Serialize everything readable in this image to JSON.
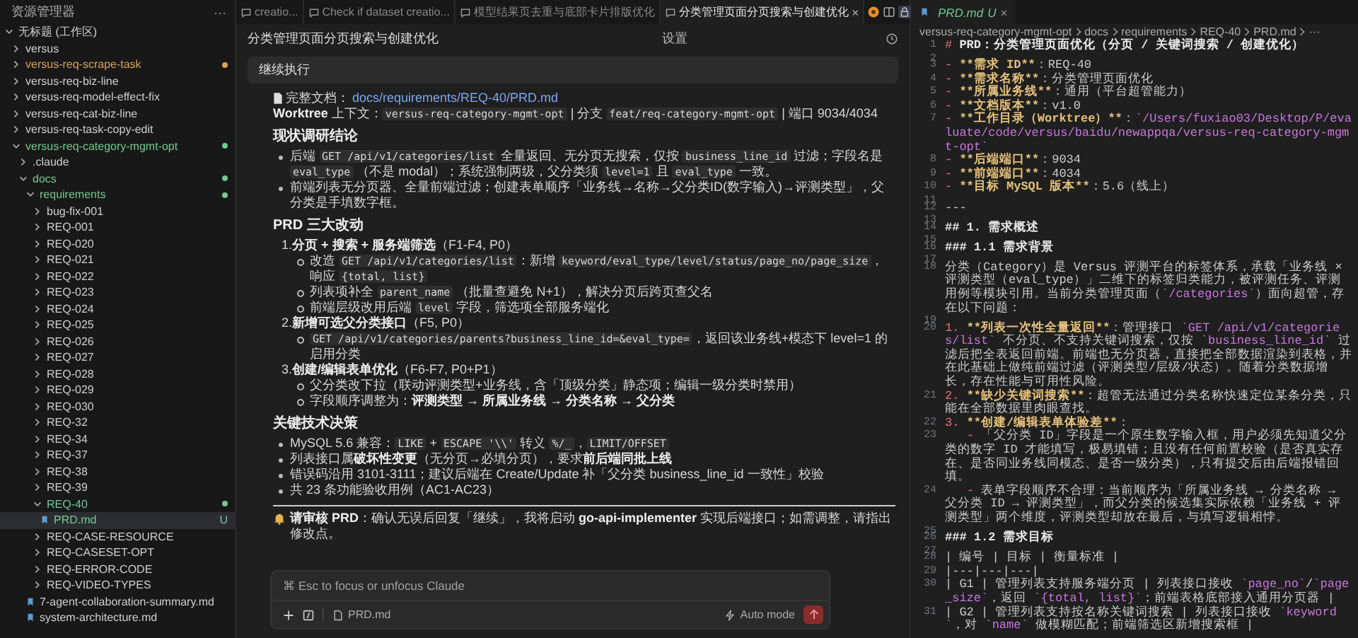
{
  "sidebar": {
    "title": "资源管理器",
    "menu": "···",
    "tree": [
      {
        "name": "无标题 (工作区)",
        "kind": "folder",
        "expanded": true,
        "children": [
          {
            "name": "versus",
            "kind": "folder",
            "expanded": false
          },
          {
            "name": "versus-req-scrape-task",
            "kind": "folder",
            "expanded": false,
            "color": "#d7a15b"
          },
          {
            "name": "versus-req-biz-line",
            "kind": "folder",
            "expanded": false
          },
          {
            "name": "versus-req-model-effect-fix",
            "kind": "folder",
            "expanded": false
          },
          {
            "name": "versus-req-cat-biz-line",
            "kind": "folder",
            "expanded": false
          },
          {
            "name": "versus-req-task-copy-edit",
            "kind": "folder",
            "expanded": false
          },
          {
            "name": "versus-req-category-mgmt-opt",
            "kind": "folder",
            "expanded": true,
            "color": "#73c991",
            "children": [
              {
                "name": ".claude",
                "kind": "folder",
                "expanded": false
              },
              {
                "name": "docs",
                "kind": "folder",
                "expanded": true,
                "color": "#73c991",
                "children": [
                  {
                    "name": "requirements",
                    "kind": "folder",
                    "expanded": true,
                    "color": "#73c991",
                    "children": [
                      {
                        "name": "bug-fix-001",
                        "kind": "folder",
                        "expanded": false
                      },
                      {
                        "name": "REQ-001",
                        "kind": "folder",
                        "expanded": false
                      },
                      {
                        "name": "REQ-020",
                        "kind": "folder",
                        "expanded": false
                      },
                      {
                        "name": "REQ-021",
                        "kind": "folder",
                        "expanded": false
                      },
                      {
                        "name": "REQ-022",
                        "kind": "folder",
                        "expanded": false
                      },
                      {
                        "name": "REQ-023",
                        "kind": "folder",
                        "expanded": false
                      },
                      {
                        "name": "REQ-024",
                        "kind": "folder",
                        "expanded": false
                      },
                      {
                        "name": "REQ-025",
                        "kind": "folder",
                        "expanded": false
                      },
                      {
                        "name": "REQ-026",
                        "kind": "folder",
                        "expanded": false
                      },
                      {
                        "name": "REQ-027",
                        "kind": "folder",
                        "expanded": false
                      },
                      {
                        "name": "REQ-028",
                        "kind": "folder",
                        "expanded": false
                      },
                      {
                        "name": "REQ-029",
                        "kind": "folder",
                        "expanded": false
                      },
                      {
                        "name": "REQ-030",
                        "kind": "folder",
                        "expanded": false
                      },
                      {
                        "name": "REQ-32",
                        "kind": "folder",
                        "expanded": false
                      },
                      {
                        "name": "REQ-34",
                        "kind": "folder",
                        "expanded": false
                      },
                      {
                        "name": "REQ-37",
                        "kind": "folder",
                        "expanded": false
                      },
                      {
                        "name": "REQ-38",
                        "kind": "folder",
                        "expanded": false
                      },
                      {
                        "name": "REQ-39",
                        "kind": "folder",
                        "expanded": false
                      },
                      {
                        "name": "REQ-40",
                        "kind": "folder",
                        "expanded": true,
                        "color": "#73c991",
                        "children": [
                          {
                            "name": "PRD.md",
                            "kind": "file",
                            "badge": "U",
                            "color": "#73c991",
                            "selected": true
                          }
                        ]
                      },
                      {
                        "name": "REQ-CASE-RESOURCE",
                        "kind": "folder",
                        "expanded": false
                      },
                      {
                        "name": "REQ-CASESET-OPT",
                        "kind": "folder",
                        "expanded": false
                      },
                      {
                        "name": "REQ-ERROR-CODE",
                        "kind": "folder",
                        "expanded": false
                      },
                      {
                        "name": "REQ-VIDEO-TYPES",
                        "kind": "folder",
                        "expanded": false
                      }
                    ]
                  },
                  {
                    "name": "7-agent-collaboration-summary.md",
                    "kind": "file",
                    "selected": false
                  },
                  {
                    "name": "system-architecture.md",
                    "kind": "file",
                    "selected": false
                  }
                ]
              }
            ]
          }
        ]
      }
    ]
  },
  "tabs": [
    {
      "label": "creatio...",
      "selected": false
    },
    {
      "label": "Check if dataset creatio...",
      "selected": false
    },
    {
      "label": "模型结果页去重与底部卡片排版优化",
      "selected": false
    },
    {
      "label": "分类管理页面分页搜索与创建优化",
      "selected": true,
      "close": "×"
    }
  ],
  "chat": {
    "title": "分类管理页面分页搜索与创建优化",
    "settings": "设置",
    "pinned_prompt": "继续执行",
    "blocks": [
      {
        "kind": "doc_link",
        "label": "完整文档：",
        "link": "docs/requirements/REQ-40/PRD.md"
      },
      {
        "kind": "para",
        "segs": [
          {
            "kind": "bold",
            "text": "Worktree"
          },
          {
            "kind": "text",
            "text": " 上下文："
          },
          {
            "kind": "code",
            "text": "versus-req-category-mgmt-opt"
          },
          {
            "kind": "text",
            "text": " | 分支 "
          },
          {
            "kind": "code",
            "text": "feat/req-category-mgmt-opt"
          },
          {
            "kind": "text",
            "text": " | 端口 9034/4034"
          }
        ]
      },
      {
        "kind": "heading",
        "text": "现状调研结论"
      },
      {
        "kind": "bullets",
        "items": [
          [
            {
              "kind": "text",
              "text": "后端 "
            },
            {
              "kind": "code",
              "text": "GET /api/v1/categories/list"
            },
            {
              "kind": "text",
              "text": " 全量返回、无分页无搜索，仅按 "
            },
            {
              "kind": "code",
              "text": "business_line_id"
            },
            {
              "kind": "text",
              "text": " 过滤；字段名是 "
            },
            {
              "kind": "code",
              "text": "eval_type"
            },
            {
              "kind": "text",
              "text": " （不是 modal）；系统强制两级，父分类须 "
            },
            {
              "kind": "code",
              "text": "level=1"
            },
            {
              "kind": "text",
              "text": " 且 "
            },
            {
              "kind": "code",
              "text": "eval_type"
            },
            {
              "kind": "text",
              "text": " 一致。"
            }
          ],
          [
            {
              "kind": "text",
              "text": "前端列表无分页器、全量前端过滤；创建表单顺序「业务线→名称→父分类ID(数字输入)→评测类型」，父分类是手填数字框。"
            }
          ]
        ]
      },
      {
        "kind": "heading",
        "text": "PRD 三大改动"
      },
      {
        "kind": "numbered",
        "items": [
          {
            "number": "1.",
            "title": [
              {
                "kind": "bold",
                "text": "分页 + 搜索 + 服务端筛选"
              },
              {
                "kind": "text",
                "text": "（F1-F4, P0）"
              }
            ],
            "children": [
              [
                {
                  "kind": "text",
                  "text": "改造 "
                },
                {
                  "kind": "code",
                  "text": "GET /api/v1/categories/list"
                },
                {
                  "kind": "text",
                  "text": "：新增 "
                },
                {
                  "kind": "code",
                  "text": "keyword/eval_type/level/status/page_no/page_size"
                },
                {
                  "kind": "text",
                  "text": "，响应 "
                },
                {
                  "kind": "code",
                  "text": "{total, list}"
                }
              ],
              [
                {
                  "kind": "text",
                  "text": "列表项补全 "
                },
                {
                  "kind": "code",
                  "text": "parent_name"
                },
                {
                  "kind": "text",
                  "text": " （批量查避免 N+1），解决分页后跨页查父名"
                }
              ],
              [
                {
                  "kind": "text",
                  "text": "前端层级改用后端 "
                },
                {
                  "kind": "code",
                  "text": "level"
                },
                {
                  "kind": "text",
                  "text": " 字段，筛选项全部服务端化"
                }
              ]
            ]
          },
          {
            "number": "2.",
            "title": [
              {
                "kind": "bold",
                "text": "新增可选父分类接口"
              },
              {
                "kind": "text",
                "text": "（F5, P0）"
              }
            ],
            "children": [
              [
                {
                  "kind": "code",
                  "text": "GET /api/v1/categories/parents?business_line_id=&eval_type="
                },
                {
                  "kind": "text",
                  "text": "，返回该业务线+模态下 level=1 的启用分类"
                }
              ]
            ]
          },
          {
            "number": "3.",
            "title": [
              {
                "kind": "bold",
                "text": "创建/编辑表单优化"
              },
              {
                "kind": "text",
                "text": "（F6-F7, P0+P1）"
              }
            ],
            "children": [
              [
                {
                  "kind": "text",
                  "text": "父分类改下拉（联动评测类型+业务线，含「顶级分类」静态项；编辑一级分类时禁用）"
                }
              ],
              [
                {
                  "kind": "text",
                  "text": "字段顺序调整为："
                },
                {
                  "kind": "bold",
                  "text": "评测类型 → 所属业务线 → 分类名称 → 父分类"
                }
              ]
            ]
          }
        ]
      },
      {
        "kind": "heading",
        "text": "关键技术决策"
      },
      {
        "kind": "bullets",
        "items": [
          [
            {
              "kind": "text",
              "text": "MySQL 5.6 兼容："
            },
            {
              "kind": "code",
              "text": "LIKE"
            },
            {
              "kind": "text",
              "text": " + "
            },
            {
              "kind": "code",
              "text": "ESCAPE '\\\\'"
            },
            {
              "kind": "text",
              "text": " 转义 "
            },
            {
              "kind": "code",
              "text": "%/_"
            },
            {
              "kind": "text",
              "text": "，"
            },
            {
              "kind": "code",
              "text": "LIMIT/OFFSET"
            }
          ],
          [
            {
              "kind": "text",
              "text": "列表接口属"
            },
            {
              "kind": "bold",
              "text": "破坏性变更"
            },
            {
              "kind": "text",
              "text": "（无分页→必填分页），要求"
            },
            {
              "kind": "bold",
              "text": "前后端同批上线"
            }
          ],
          [
            {
              "kind": "text",
              "text": "错误码沿用 3101-3111；建议后端在 Create/Update 补「父分类 business_line_id 一致性」校验"
            }
          ],
          [
            {
              "kind": "text",
              "text": "共 23 条功能验收用例（AC1-AC23）"
            }
          ]
        ]
      },
      {
        "kind": "rule"
      },
      {
        "kind": "notice",
        "segs": [
          {
            "kind": "bold",
            "text": "请审核 PRD"
          },
          {
            "kind": "text",
            "text": "：确认无误后回复「继续」，我将启动 "
          },
          {
            "kind": "bold",
            "text": "go-api-implementer"
          },
          {
            "kind": "text",
            "text": " 实现后端接口；如需调整，请指出修改点。"
          }
        ]
      }
    ],
    "composer": {
      "placeholder": "⌘ Esc to focus or unfocus Claude",
      "attachment": "PRD.md",
      "mode": "Auto mode"
    }
  },
  "editor": {
    "tab": {
      "label": "PRD.md",
      "badge": "U",
      "close": "×"
    },
    "breadcrumb": [
      "versus-req-category-mgmt-opt",
      "docs",
      "requirements",
      "REQ-40",
      "PRD.md",
      "···"
    ],
    "lines": [
      {
        "num": "1",
        "segs": [
          {
            "kind": "mark",
            "text": "# "
          },
          {
            "kind": "heading",
            "text": "PRD：分类管理页面优化（分页 / 关键词搜索 / 创建优化）"
          }
        ]
      },
      {
        "num": "2"
      },
      {
        "num": "3",
        "segs": [
          {
            "kind": "mark",
            "text": "- "
          },
          {
            "kind": "bold",
            "text": "**需求 ID**"
          },
          {
            "kind": "text",
            "text": "：REQ-40"
          }
        ]
      },
      {
        "num": "4",
        "segs": [
          {
            "kind": "mark",
            "text": "- "
          },
          {
            "kind": "bold",
            "text": "**需求名称**"
          },
          {
            "kind": "text",
            "text": "：分类管理页面优化"
          }
        ]
      },
      {
        "num": "5",
        "segs": [
          {
            "kind": "mark",
            "text": "- "
          },
          {
            "kind": "bold",
            "text": "**所属业务线**"
          },
          {
            "kind": "text",
            "text": "：通用（平台超管能力）"
          }
        ]
      },
      {
        "num": "6",
        "segs": [
          {
            "kind": "mark",
            "text": "- "
          },
          {
            "kind": "bold",
            "text": "**文档版本**"
          },
          {
            "kind": "text",
            "text": "：v1.0"
          }
        ]
      },
      {
        "num": "7",
        "segs": [
          {
            "kind": "mark",
            "text": "- "
          },
          {
            "kind": "bold",
            "text": "**工作目录（Worktree）**"
          },
          {
            "kind": "text",
            "text": "："
          },
          {
            "kind": "code",
            "text": "`/Users/fuxiao03/Desktop/P/evaluate/code/versus/baidu/newappqa/versus-req-category-mgmt-opt`"
          }
        ]
      },
      {
        "num": "8",
        "segs": [
          {
            "kind": "mark",
            "text": "- "
          },
          {
            "kind": "bold",
            "text": "**后端端口**"
          },
          {
            "kind": "text",
            "text": "：9034"
          }
        ]
      },
      {
        "num": "9",
        "segs": [
          {
            "kind": "mark",
            "text": "- "
          },
          {
            "kind": "bold",
            "text": "**前端端口**"
          },
          {
            "kind": "text",
            "text": "：4034"
          }
        ]
      },
      {
        "num": "10",
        "segs": [
          {
            "kind": "mark",
            "text": "- "
          },
          {
            "kind": "bold",
            "text": "**目标 MySQL 版本**"
          },
          {
            "kind": "text",
            "text": "：5.6（线上）"
          }
        ]
      },
      {
        "num": "11"
      },
      {
        "num": "12",
        "segs": [
          {
            "kind": "text",
            "text": "---"
          }
        ]
      },
      {
        "num": "13"
      },
      {
        "num": "14",
        "segs": [
          {
            "kind": "heading",
            "text": "## 1. 需求概述"
          }
        ]
      },
      {
        "num": "15"
      },
      {
        "num": "16",
        "segs": [
          {
            "kind": "heading",
            "text": "### 1.1 需求背景"
          }
        ]
      },
      {
        "num": "17"
      },
      {
        "num": "18",
        "segs": [
          {
            "kind": "text",
            "text": "分类（Category）是 Versus 评测平台的标签体系，承载「业务线 × 评测类型（eval_type）」二维下的标签归类能力，被评测任务、评测用例等模块引用。当前分类管理页面（"
          },
          {
            "kind": "code",
            "text": "`/categories`"
          },
          {
            "kind": "text",
            "text": "）面向超管，存在以下问题："
          }
        ]
      },
      {
        "num": "19"
      },
      {
        "num": "20",
        "segs": [
          {
            "kind": "mark",
            "text": "1. "
          },
          {
            "kind": "bold",
            "text": "**列表一次性全量返回**"
          },
          {
            "kind": "text",
            "text": "：管理接口 "
          },
          {
            "kind": "code",
            "text": "`GET /api/v1/categories/list`"
          },
          {
            "kind": "text",
            "text": " 不分页、不支持关键词搜索，仅按 "
          },
          {
            "kind": "code",
            "text": "`business_line_id`"
          },
          {
            "kind": "text",
            "text": " 过滤后把全表返回前端。前端也无分页器，直接把全部数据渲染到表格，并在此基础上做纯前端过滤（评测类型/层级/状态）。随着分类数据增长，存在性能与可用性风险。"
          }
        ]
      },
      {
        "num": "21",
        "segs": [
          {
            "kind": "mark",
            "text": "2. "
          },
          {
            "kind": "bold",
            "text": "**缺少关键词搜索**"
          },
          {
            "kind": "text",
            "text": "：超管无法通过分类名称快速定位某条分类，只能在全部数据里肉眼查找。"
          }
        ]
      },
      {
        "num": "22",
        "segs": [
          {
            "kind": "mark",
            "text": "3. "
          },
          {
            "kind": "bold",
            "text": "**创建/编辑表单体验差**"
          },
          {
            "kind": "text",
            "text": "："
          }
        ]
      },
      {
        "num": "23",
        "segs": [
          {
            "kind": "mark",
            "text": "   - "
          },
          {
            "kind": "text",
            "text": "「父分类 ID」字段是一个原生数字输入框，用户必须先知道父分类的数字 ID 才能填写，极易填错；且没有任何前置校验（是否真实存在、是否同业务线同模态、是否一级分类），只有提交后由后端报错回填。"
          }
        ]
      },
      {
        "num": "24",
        "segs": [
          {
            "kind": "mark",
            "text": "   - "
          },
          {
            "kind": "text",
            "text": "表单字段顺序不合理：当前顺序为「所属业务线 → 分类名称 → 父分类 ID → 评测类型」，而父分类的候选集实际依赖「业务线 + 评测类型」两个维度，评测类型却放在最后，与填写逻辑相悖。"
          }
        ]
      },
      {
        "num": "25"
      },
      {
        "num": "26",
        "segs": [
          {
            "kind": "heading",
            "text": "### 1.2 需求目标"
          }
        ]
      },
      {
        "num": "27"
      },
      {
        "num": "28",
        "segs": [
          {
            "kind": "text",
            "text": "| 编号 | 目标 | 衡量标准 |"
          }
        ]
      },
      {
        "num": "29",
        "segs": [
          {
            "kind": "text",
            "text": "|---|---|---|"
          }
        ]
      },
      {
        "num": "30",
        "segs": [
          {
            "kind": "text",
            "text": "| G1 | 管理列表支持服务端分页 | 列表接口接收 "
          },
          {
            "kind": "code",
            "text": "`page_no`"
          },
          {
            "kind": "text",
            "text": "/"
          },
          {
            "kind": "code",
            "text": "`page_size`"
          },
          {
            "kind": "text",
            "text": "，返回 "
          },
          {
            "kind": "code",
            "text": "`{total, list}`"
          },
          {
            "kind": "text",
            "text": "；前端表格底部接入通用分页器 |"
          }
        ]
      },
      {
        "num": "31",
        "segs": [
          {
            "kind": "text",
            "text": "| G2 | 管理列表支持按名称关键词搜索 | 列表接口接收 "
          },
          {
            "kind": "code",
            "text": "`keyword`"
          },
          {
            "kind": "text",
            "text": "，对 "
          },
          {
            "kind": "code",
            "text": "`name`"
          },
          {
            "kind": "text",
            "text": " 做模糊匹配；前端筛选区新增搜索框 |"
          }
        ]
      }
    ]
  }
}
